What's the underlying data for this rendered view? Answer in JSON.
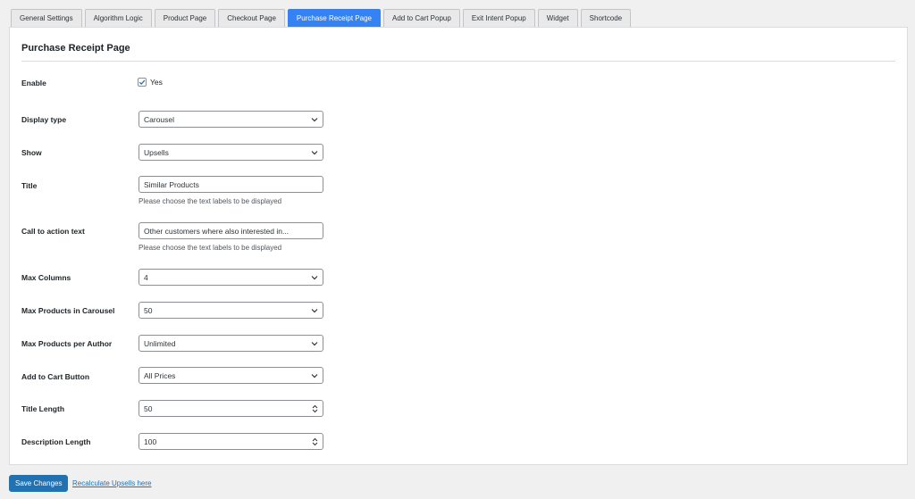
{
  "tabs": [
    {
      "label": "General Settings"
    },
    {
      "label": "Algorithm Logic"
    },
    {
      "label": "Product Page"
    },
    {
      "label": "Checkout Page"
    },
    {
      "label": "Purchase Receipt Page"
    },
    {
      "label": "Add to Cart Popup"
    },
    {
      "label": "Exit Intent Popup"
    },
    {
      "label": "Widget"
    },
    {
      "label": "Shortcode"
    }
  ],
  "active_tab": "Purchase Receipt Page",
  "panel": {
    "title": "Purchase Receipt Page"
  },
  "fields": {
    "enable": {
      "label": "Enable",
      "checked": true,
      "option_label": "Yes"
    },
    "display_type": {
      "label": "Display type",
      "value": "Carousel"
    },
    "show": {
      "label": "Show",
      "value": "Upsells"
    },
    "title": {
      "label": "Title",
      "value": "Similar Products",
      "help": "Please choose the text labels to be displayed"
    },
    "cta_text": {
      "label": "Call to action text",
      "value": "Other customers where also interested in...",
      "help": "Please choose the text labels to be displayed"
    },
    "max_columns": {
      "label": "Max Columns",
      "value": "4"
    },
    "max_products_carousel": {
      "label": "Max Products in Carousel",
      "value": "50"
    },
    "max_products_author": {
      "label": "Max Products per Author",
      "value": "Unlimited"
    },
    "add_to_cart_button": {
      "label": "Add to Cart Button",
      "value": "All Prices"
    },
    "title_length": {
      "label": "Title Length",
      "value": "50"
    },
    "description_length": {
      "label": "Description Length",
      "value": "100"
    }
  },
  "footer": {
    "save_label": "Save Changes",
    "recalc_label": "Recalculate Upsells here"
  },
  "colors": {
    "accent": "#3582f3",
    "button": "#2271b1",
    "link": "#2271b1"
  }
}
